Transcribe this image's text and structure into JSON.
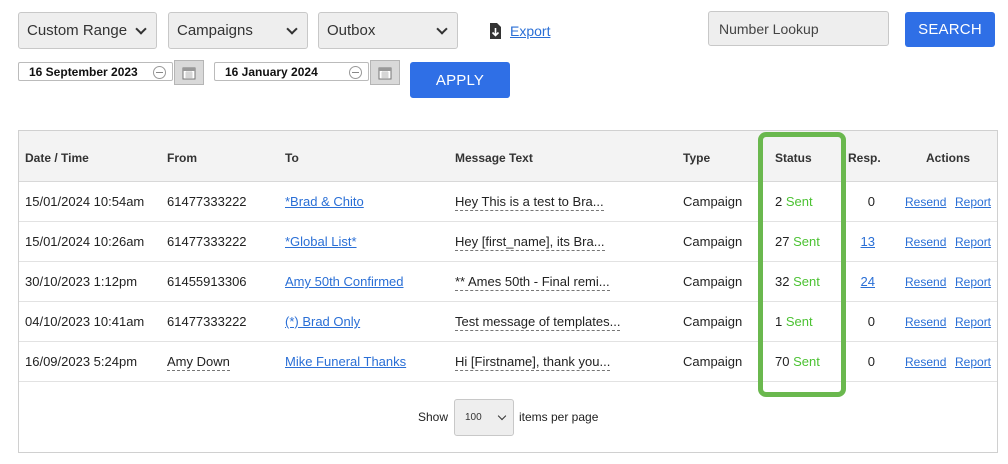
{
  "filters": {
    "range": "Custom Range",
    "type": "Campaigns",
    "box": "Outbox",
    "export_label": "Export"
  },
  "lookup": {
    "placeholder": "Number Lookup",
    "search_label": "SEARCH"
  },
  "dates": {
    "start": "16 September 2023",
    "end": "16 January 2024",
    "apply_label": "APPLY"
  },
  "table": {
    "headers": {
      "date": "Date / Time",
      "from": "From",
      "to": "To",
      "message": "Message Text",
      "type": "Type",
      "status": "Status",
      "resp": "Resp.",
      "actions": "Actions"
    },
    "rows": [
      {
        "date": "15/01/2024 10:54am",
        "from": "61477333222",
        "to": "*Brad & Chito",
        "message": "Hey This is a test to Bra...",
        "type": "Campaign",
        "count": "2",
        "status": "Sent",
        "resp": "0",
        "resend": "Resend",
        "report": "Report"
      },
      {
        "date": "15/01/2024 10:26am",
        "from": "61477333222",
        "to": "*Global List*",
        "message": "Hey [first_name], its Bra...",
        "type": "Campaign",
        "count": "27",
        "status": "Sent",
        "resp": "13",
        "resend": "Resend",
        "report": "Report"
      },
      {
        "date": "30/10/2023 1:12pm",
        "from": "61455913306",
        "to": "Amy 50th Confirmed",
        "message": "** Ames 50th - Final remi...",
        "type": "Campaign",
        "count": "32",
        "status": "Sent",
        "resp": "24",
        "resend": "Resend",
        "report": "Report"
      },
      {
        "date": "04/10/2023 10:41am",
        "from": "61477333222",
        "to": "(*) Brad Only",
        "message": "Test message of templates...",
        "type": "Campaign",
        "count": "1",
        "status": "Sent",
        "resp": "0",
        "resend": "Resend",
        "report": "Report"
      },
      {
        "date": "16/09/2023 5:24pm",
        "from": "Amy Down",
        "to": "Mike Funeral Thanks",
        "message": "Hi [Firstname], thank you...",
        "type": "Campaign",
        "count": "70",
        "status": "Sent",
        "resp": "0",
        "resend": "Resend",
        "report": "Report"
      }
    ]
  },
  "pagination": {
    "show_label": "Show",
    "per_page_value": "100",
    "suffix_label": "items per page"
  },
  "colors": {
    "accent": "#2f6fe6",
    "link": "#2a6fd6",
    "sent": "#4cc233",
    "highlight": "#6ab84e"
  },
  "icons": {
    "export": "export-icon",
    "calendar": "calendar-icon",
    "clear": "clear-icon"
  }
}
